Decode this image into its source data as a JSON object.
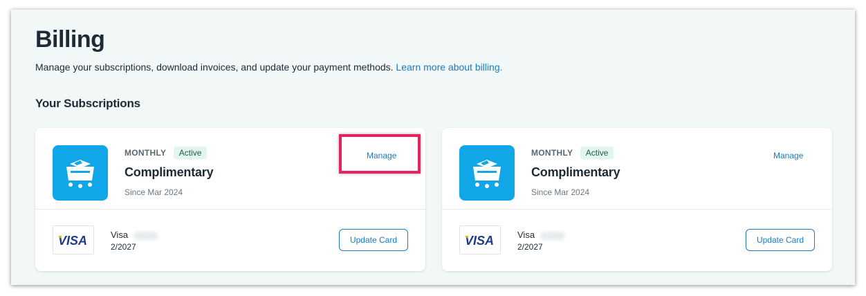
{
  "page": {
    "title": "Billing",
    "description": "Manage your subscriptions, download invoices, and update your payment methods.",
    "learn_more_link": "Learn more about billing.",
    "section_title": "Your Subscriptions"
  },
  "colors": {
    "accent": "#1a7ac4",
    "icon_bg": "#11a6e8",
    "highlight": "#e5245f",
    "badge_bg": "#e3f5ef",
    "visa_blue": "#1a3b8e",
    "visa_gold": "#f2a900"
  },
  "subscriptions": [
    {
      "icon": "shopping-cart-box-icon",
      "frequency": "MONTHLY",
      "status": "Active",
      "plan_name": "Complimentary",
      "since": "Since Mar 2024",
      "manage_label": "Manage",
      "payment": {
        "brand_logo": "VISA",
        "brand": "Visa",
        "expiry": "2/2027",
        "update_label": "Update Card"
      }
    },
    {
      "icon": "shopping-cart-box-icon",
      "frequency": "MONTHLY",
      "status": "Active",
      "plan_name": "Complimentary",
      "since": "Since Mar 2024",
      "manage_label": "Manage",
      "payment": {
        "brand_logo": "VISA",
        "brand": "Visa",
        "expiry": "2/2027",
        "update_label": "Update Card"
      }
    }
  ]
}
